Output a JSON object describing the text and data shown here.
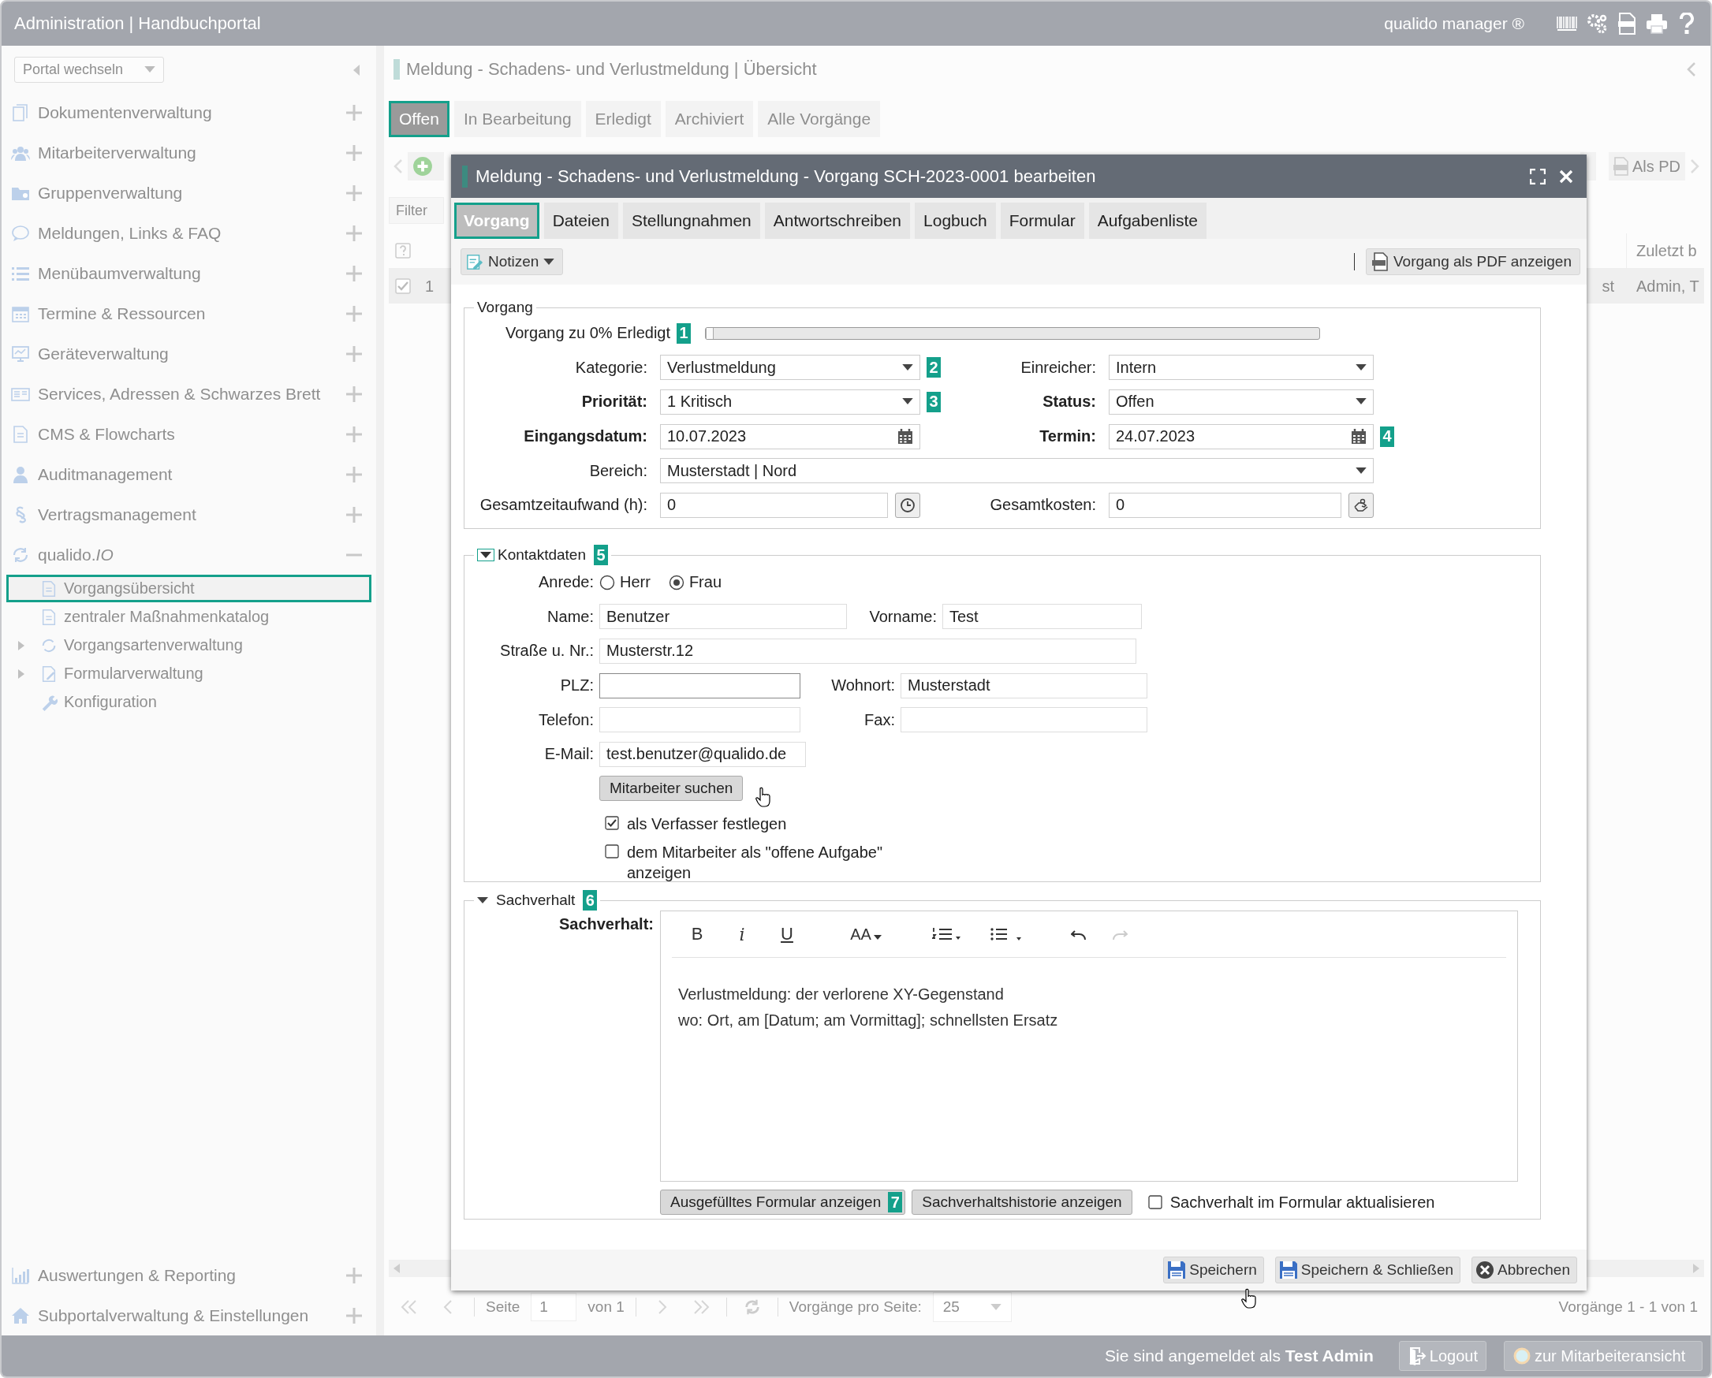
{
  "app_bar": {
    "title": "Administration | Handbuchportal",
    "product": "qualido manager ®"
  },
  "sidebar": {
    "portal_select": "Portal wechseln",
    "items": [
      {
        "label": "Dokumentenverwaltung",
        "expanded": false
      },
      {
        "label": "Mitarbeiterverwaltung",
        "expanded": false
      },
      {
        "label": "Gruppenverwaltung",
        "expanded": false
      },
      {
        "label": "Meldungen, Links & FAQ",
        "expanded": false
      },
      {
        "label": "Menübaumverwaltung",
        "expanded": false
      },
      {
        "label": "Termine & Ressourcen",
        "expanded": false
      },
      {
        "label": "Geräteverwaltung",
        "expanded": false
      },
      {
        "label": "Services, Adressen & Schwarzes Brett",
        "expanded": false
      },
      {
        "label": "CMS & Flowcharts",
        "expanded": false
      },
      {
        "label": "Auditmanagement",
        "expanded": false
      },
      {
        "label": "Vertragsmanagement",
        "expanded": false
      },
      {
        "label": "qualido.*IO*",
        "expanded": true,
        "children": [
          {
            "label": "Vorgangsübersicht",
            "selected": true,
            "has_children": false
          },
          {
            "label": "zentraler Maßnahmenkatalog",
            "selected": false,
            "has_children": false
          },
          {
            "label": "Vorgangsartenverwaltung",
            "selected": false,
            "has_children": true
          },
          {
            "label": "Formularverwaltung",
            "selected": false,
            "has_children": true
          },
          {
            "label": "Konfiguration",
            "selected": false,
            "has_children": false
          }
        ]
      }
    ],
    "bottom_items": [
      {
        "label": "Auswertungen & Reporting",
        "expanded": false
      },
      {
        "label": "Subportalverwaltung & Einstellungen",
        "expanded": false
      }
    ]
  },
  "main": {
    "title": "Meldung - Schadens- und Verlustmeldung | Übersicht",
    "tabs": [
      {
        "label": "Offen",
        "selected": true
      },
      {
        "label": "In Bearbeitung",
        "selected": false
      },
      {
        "label": "Erledigt",
        "selected": false
      },
      {
        "label": "Archiviert",
        "selected": false
      },
      {
        "label": "Alle Vorgänge",
        "selected": false
      }
    ],
    "pdf_button": "Als PD",
    "filter_placeholder": "Filter",
    "table": {
      "column_last": "Zuletzt b",
      "row": {
        "checked": true,
        "number": "1",
        "cell_a": "st",
        "cell_b": "Admin, T"
      }
    },
    "pager": {
      "page_label": "Seite",
      "page": "1",
      "of": "von 1",
      "per_page_label": "Vorgänge pro Seite:",
      "per_page": "25",
      "summary": "Vorgänge 1 - 1 von 1"
    }
  },
  "dialog": {
    "title": "Meldung - Schadens- und Verlustmeldung - Vorgang SCH-2023-0001 bearbeiten",
    "tabs": [
      {
        "label": "Vorgang",
        "selected": true
      },
      {
        "label": "Dateien",
        "selected": false
      },
      {
        "label": "Stellungnahmen",
        "selected": false
      },
      {
        "label": "Antwortschreiben",
        "selected": false
      },
      {
        "label": "Logbuch",
        "selected": false
      },
      {
        "label": "Formular",
        "selected": false
      },
      {
        "label": "Aufgabenliste",
        "selected": false
      }
    ],
    "notes_button": "Notizen",
    "pdf_button": "Vorgang als PDF anzeigen",
    "vorgang": {
      "legend": "Vorgang",
      "progress": {
        "label": "Vorgang zu 0% Erledigt",
        "badge": "1",
        "level": 0
      },
      "rows": [
        [
          {
            "label": "Kategorie:",
            "value": "Verlustmeldung",
            "kind": "select",
            "required": false,
            "badge": "2"
          },
          {
            "label": "Einreicher:",
            "value": "Intern",
            "kind": "select",
            "required": false
          }
        ],
        [
          {
            "label": "Priorität:",
            "value": "1 Kritisch",
            "kind": "select",
            "required": true,
            "badge": "3"
          },
          {
            "label": "Status:",
            "value": "Offen",
            "kind": "select",
            "required": true
          }
        ],
        [
          {
            "label": "Eingangsdatum:",
            "value": "10.07.2023",
            "kind": "date",
            "required": true
          },
          {
            "label": "Termin:",
            "value": "24.07.2023",
            "kind": "date",
            "required": true,
            "badge": "4"
          }
        ],
        [
          {
            "label": "Bereich:",
            "value": "Musterstadt | Nord",
            "kind": "select",
            "required": false
          }
        ],
        [
          {
            "label": "Gesamtzeitaufwand (h):",
            "value": "0",
            "kind": "timer",
            "required": false
          },
          {
            "label": "Gesamtkosten:",
            "value": "0",
            "kind": "money",
            "required": false
          }
        ]
      ]
    },
    "kontakt": {
      "legend": "Kontaktdaten",
      "expanded": true,
      "badge": "5",
      "salutation": {
        "label": "Anrede:",
        "options": [
          {
            "label": "Herr",
            "selected": false
          },
          {
            "label": "Frau",
            "selected": true
          }
        ]
      },
      "rows": [
        [
          {
            "label": "Name:",
            "value": "Benutzer",
            "focused": false
          },
          {
            "label": "Vorname:",
            "value": "Test",
            "focused": false
          }
        ],
        [
          {
            "label": "Straße u. Nr.:",
            "value": "Musterstr.12",
            "focused": false
          }
        ],
        [
          {
            "label": "PLZ:",
            "focused": true
          },
          {
            "label": "Wohnort:",
            "value": "Musterstadt",
            "focused": false
          }
        ],
        [
          {
            "label": "Telefon:",
            "focused": false
          },
          {
            "label": "Fax:",
            "focused": false
          }
        ],
        [
          {
            "label": "E-Mail:",
            "value": "test.benutzer@qualido.de",
            "focused": false
          }
        ]
      ],
      "search_button": "Mitarbeiter suchen",
      "options": [
        {
          "label": "als Verfasser festlegen",
          "checked": true
        },
        {
          "label": "dem Mitarbeiter als \"offene Aufgabe\" anzeigen",
          "checked": false
        }
      ]
    },
    "sachverhalt": {
      "legend": "Sachverhalt",
      "expanded": true,
      "badge": "6",
      "label": "Sachverhalt:",
      "format_buttons": [
        "B",
        "i",
        "U"
      ],
      "font_size_button": "AA",
      "undo_disabled": false,
      "redo_disabled": true,
      "lines": [
        "Verlustmeldung: der verlorene XY-Gegenstand",
        "wo: Ort, am [Datum; am Vormittag]; schnellsten Ersatz"
      ],
      "buttons": [
        {
          "label": "Ausgefülltes Formular anzeigen",
          "badge": "7"
        },
        {
          "label": "Sachverhaltshistorie anzeigen"
        }
      ],
      "update_option": {
        "label": "Sachverhalt im Formular aktualisieren",
        "checked": false
      }
    },
    "footer_buttons": [
      {
        "label": "Speichern",
        "kind": "save"
      },
      {
        "label": "Speichern & Schließen",
        "kind": "save"
      },
      {
        "label": "Abbrechen",
        "kind": "cancel"
      }
    ]
  },
  "status_bar": {
    "login_text": "Sie sind angemeldet als **Test Admin**",
    "logout": "Logout",
    "staff_view": "zur Mitarbeiteransicht"
  }
}
